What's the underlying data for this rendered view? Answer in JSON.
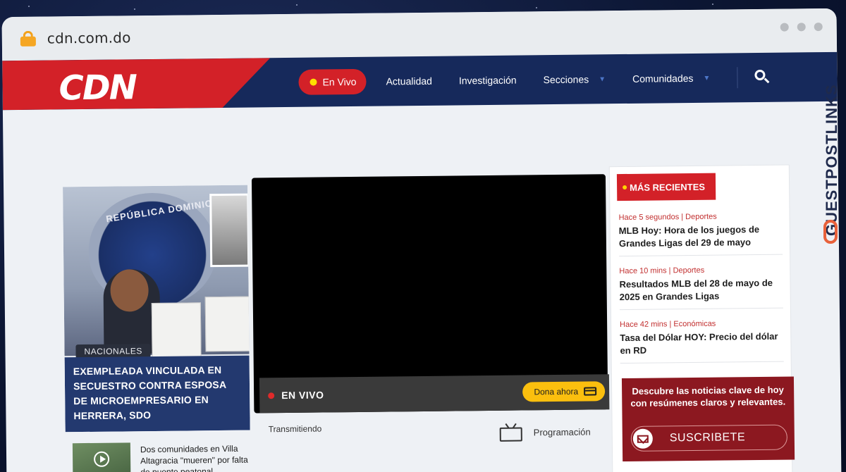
{
  "browser": {
    "url": "cdn.com.do"
  },
  "site": {
    "logo": "CDN",
    "nav": {
      "live_label": "En Vivo",
      "items": [
        "Actualidad",
        "Investigación",
        "Secciones",
        "Comunidades"
      ]
    }
  },
  "featured": {
    "category": "NACIONALES",
    "seal_text": "REPÚBLICA DOMINICANA",
    "headline": "EXEMPLEADA VINCULADA EN SECUESTRO CONTRA ESPOSA DE MICROEMPRESARIO EN HERRERA, SDO"
  },
  "video": {
    "live_text": "EN VIVO",
    "donate_label": "Dona ahora",
    "transmitting_label": "Transmitiendo",
    "schedule_label": "Programación"
  },
  "small_story": {
    "title": "Dos comunidades en Villa Altagracia \"mueren\" por falta de puente peatonal"
  },
  "sidebar": {
    "header": "MÁS RECIENTES",
    "items": [
      {
        "meta": "Hace 5 segundos | Deportes",
        "title": "MLB Hoy: Hora de los juegos de Grandes Ligas del 29 de mayo"
      },
      {
        "meta": "Hace 10 mins | Deportes",
        "title": "Resultados MLB del 28 de mayo de 2025 en Grandes Ligas"
      },
      {
        "meta": "Hace 42 mins | Económicas",
        "title": "Tasa del Dólar HOY: Precio del dólar en RD"
      }
    ],
    "subscribe_text": "Descubre las noticias clave de hoy con resúmenes claros y relevantes.",
    "subscribe_button": "SUSCRIBETE"
  },
  "watermark": "GUESTPOSTLINKS",
  "colors": {
    "brand_red": "#d32128",
    "nav_blue": "#16295b",
    "donate_yellow": "#fbbf0e",
    "subscribe_bg": "#8c1820"
  }
}
